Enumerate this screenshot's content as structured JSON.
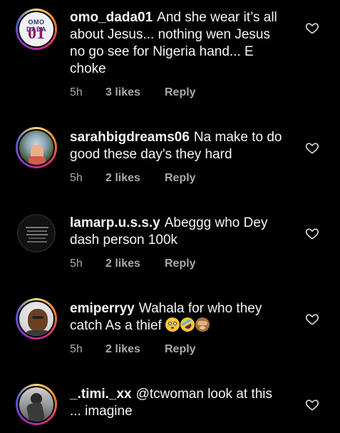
{
  "comments": [
    {
      "username": "omo_dada01",
      "text": "And she wear it’s all about Jesus... nothing wen Jesus no go see for Nigeria hand... E choke",
      "time": "5h",
      "likes": "3 likes",
      "reply": "Reply",
      "avatar_label_top": "OMO DADA",
      "avatar_label_num": "01"
    },
    {
      "username": "sarahbigdreams06",
      "text": "Na make to do good these day's they hard",
      "time": "5h",
      "likes": "2 likes",
      "reply": "Reply"
    },
    {
      "username": "lamarp.u.s.s.y",
      "text": "Abeggg who Dey dash person 100k",
      "time": "5h",
      "likes": "2 likes",
      "reply": "Reply"
    },
    {
      "username": "emiperryy",
      "text": "Wahala for who they catch As a thief",
      "emojis": [
        "flushed-face",
        "rolling-laughing-face",
        "see-no-evil-monkey"
      ],
      "time": "5h",
      "likes": "2 likes",
      "reply": "Reply"
    },
    {
      "username": "_.timi._xx",
      "text": "@tcwoman look at this ... imagine"
    }
  ],
  "colors": {
    "background": "#000000",
    "text": "#f5f5f5",
    "meta": "#a8a8a8"
  }
}
